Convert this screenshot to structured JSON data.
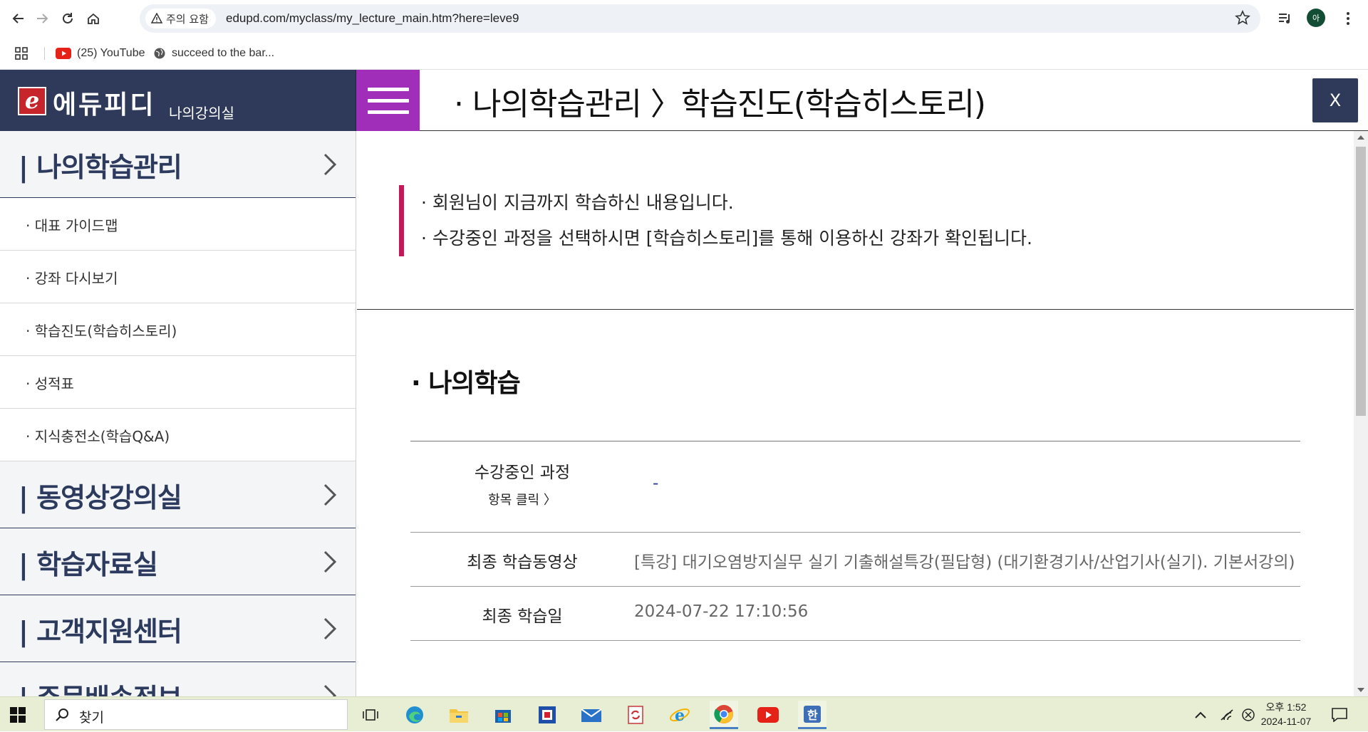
{
  "browser": {
    "security_chip": "주의 요함",
    "url": "edupd.com/myclass/my_lecture_main.htm?here=leve9",
    "profile_initial": "아",
    "bookmarks": [
      {
        "label": "(25) YouTube",
        "icon": "youtube-icon"
      },
      {
        "label": "succeed to the bar...",
        "icon": "globe-icon"
      }
    ]
  },
  "site": {
    "logo_mark": "e",
    "logo_text": "에듀피디",
    "logo_sub": "나의강의실",
    "brand_color": "#2f3a5a",
    "menu_color": "#a12eb8",
    "breadcrumb": "· 나의학습관리 〉학습진도(학습히스토리)",
    "close_label": "X"
  },
  "sidebar": {
    "sections": [
      {
        "title": "| 나의학습관리",
        "items": [
          "· 대표 가이드맵",
          "· 강좌 다시보기",
          "· 학습진도(학습히스토리)",
          "· 성적표",
          "· 지식충전소(학습Q&A)"
        ]
      },
      {
        "title": "| 동영상강의실",
        "items": []
      },
      {
        "title": "| 학습자료실",
        "items": []
      },
      {
        "title": "| 고객지원센터",
        "items": []
      },
      {
        "title": "| 주문배송정보",
        "items": []
      }
    ]
  },
  "main": {
    "notice_lines": [
      "· 회원님이 지금까지 학습하신 내용입니다.",
      "· 수강중인 과정을 선택하시면 [학습히스토리]를 통해 이용하신 강좌가 확인됩니다."
    ],
    "notice_accent": "#c4185a",
    "section_title": "· 나의학습",
    "table": {
      "course_label": "수강중인 과정",
      "course_hint": "항목 클릭 〉",
      "course_value": "-",
      "last_video_label": "최종 학습동영상",
      "last_video_value": "[특강] 대기오염방지실무 실기 기출해설특강(필답형) (대기환경기사/산업기사(실기). 기본서강의)",
      "last_date_label": "최종 학습일",
      "last_date_value": "2024-07-22 17:10:56"
    }
  },
  "taskbar": {
    "search_placeholder": "찾기",
    "clock_time": "오후 1:52",
    "clock_date": "2024-11-07",
    "apps": [
      "task-view-icon",
      "edge-icon",
      "file-explorer-icon",
      "store-icon",
      "app-red-icon",
      "mail-icon",
      "sync-app-icon",
      "internet-explorer-icon",
      "chrome-icon",
      "youtube-icon",
      "hangul-icon"
    ]
  }
}
